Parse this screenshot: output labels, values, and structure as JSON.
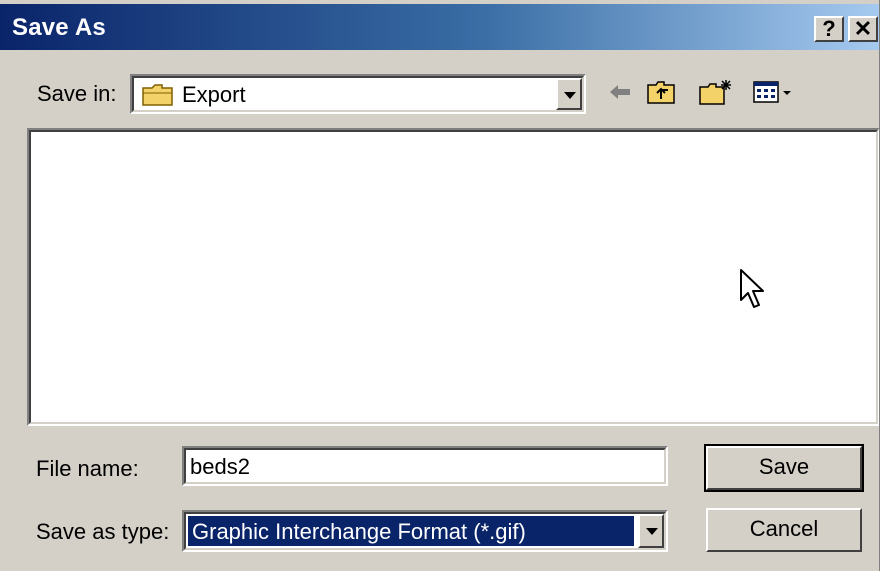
{
  "window": {
    "title": "Save As",
    "help_label": "?",
    "close_label": "✕"
  },
  "save_in": {
    "label": "Save in:",
    "value": "Export"
  },
  "toolbar": {
    "icons": [
      "back-arrow-icon",
      "up-one-level-icon",
      "create-new-folder-icon",
      "view-menu-icon"
    ]
  },
  "file_name": {
    "label": "File name:",
    "value": "beds2"
  },
  "save_as_type": {
    "label": "Save as type:",
    "value": "Graphic Interchange Format (*.gif)"
  },
  "buttons": {
    "save": "Save",
    "cancel": "Cancel"
  },
  "colors": {
    "title_start": "#0a246a",
    "title_end": "#a6caf0",
    "selection": "#0a246a",
    "face": "#d4d0c8"
  }
}
